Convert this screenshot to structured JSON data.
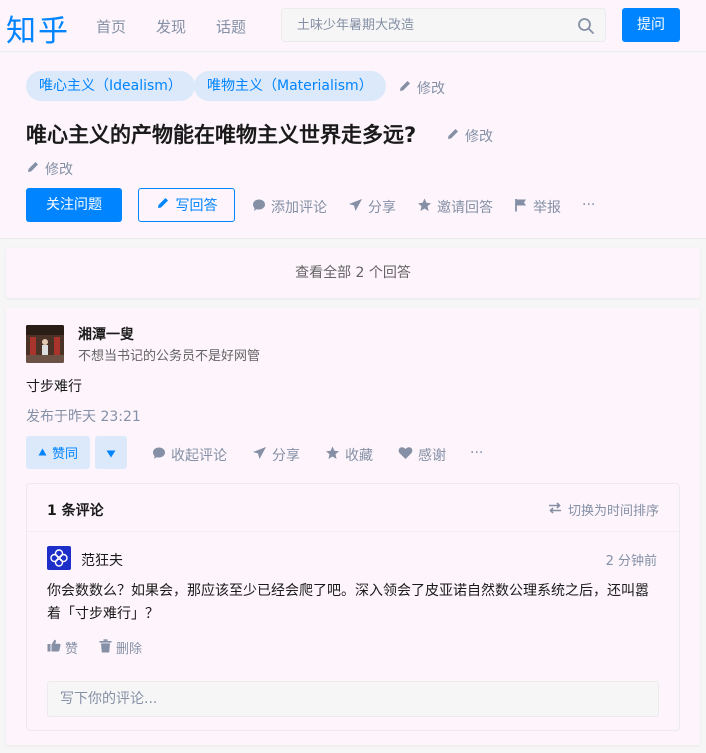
{
  "header": {
    "logo": "知乎",
    "nav": [
      "首页",
      "发现",
      "话题"
    ],
    "search_placeholder": "土味少年暑期大改造",
    "ask_label": "提问"
  },
  "question": {
    "topics": [
      "唯心主义（Idealism）",
      "唯物主义（Materialism）"
    ],
    "edit_label": "修改",
    "title": "唯心主义的产物能在唯物主义世界走多远?",
    "follow_label": "关注问题",
    "write_label": "写回答",
    "actions": {
      "comment": "添加评论",
      "share": "分享",
      "invite": "邀请回答",
      "report": "举报",
      "more": "···"
    }
  },
  "view_all_label": "查看全部 2 个回答",
  "answer": {
    "author": "湘潭一叟",
    "bio": "不想当书记的公务员不是好网管",
    "content": "寸步难行",
    "published": "发布于昨天 23:21",
    "vote_label": "赞同",
    "actions": {
      "collapse_comments": "收起评论",
      "share": "分享",
      "favorite": "收藏",
      "thanks": "感谢",
      "more": "···"
    }
  },
  "comments": {
    "count_label": "1 条评论",
    "sort_label": "切换为时间排序",
    "items": [
      {
        "author": "范狂夫",
        "time": "2 分钟前",
        "text": "你会数数么？如果会，那应该至少已经会爬了吧。深入领会了皮亚诺自然数公理系统之后，还叫嚣着「寸步难行」？",
        "like_label": "赞",
        "delete_label": "删除"
      }
    ],
    "input_placeholder": "写下你的评论..."
  },
  "colors": {
    "brand": "#0084ff",
    "muted": "#8590a6",
    "tag_bg": "#dce9fb",
    "page_bg": "#fdf5fb"
  }
}
